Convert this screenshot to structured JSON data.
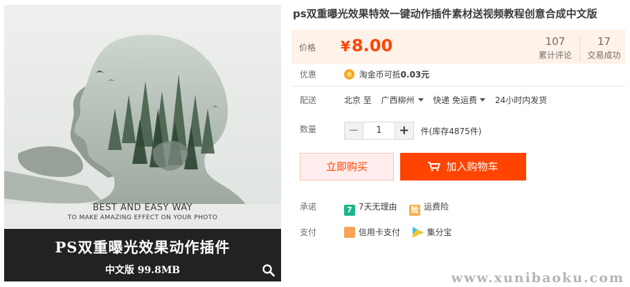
{
  "image": {
    "caption_line1": "BEST AND EASY WAY",
    "caption_line2": "TO MAKE AMAZING  EFFECT ON YOUR PHOTO",
    "band_title": "PS双重曝光效果动作插件",
    "band_subtitle": "中文版  99.8MB",
    "zoom_icon": "search-icon"
  },
  "product": {
    "title": "ps双重曝光效果特效一键动作插件素材送视频教程创意合成中文版"
  },
  "price": {
    "label": "价格",
    "currency": "¥",
    "amount": "8.00",
    "color": "#ff4400"
  },
  "stats": {
    "reviews_count": "107",
    "reviews_label": "累计评论",
    "sales_count": "17",
    "sales_label": "交易成功"
  },
  "promo": {
    "label": "优惠",
    "icon": "coin-icon",
    "text_prefix": "淘金币可抵",
    "text_amount": "0.03元"
  },
  "shipping": {
    "label": "配送",
    "from": "北京 至",
    "to": "广西柳州",
    "method": "快递 免运费",
    "dispatch": "24小时内发货"
  },
  "quantity": {
    "label": "数量",
    "value": "1",
    "minus": "−",
    "plus": "+",
    "stock_text": "件(库存4875件)"
  },
  "actions": {
    "buy_now": "立即购买",
    "add_to_cart": "加入购物车",
    "accent": "#ff4400"
  },
  "promise": {
    "label": "承诺",
    "items": [
      "7天无理由",
      "运费险"
    ]
  },
  "payment": {
    "label": "支付",
    "items": [
      "信用卡支付",
      "集分宝"
    ]
  },
  "watermark": "www.xunibaoku.com"
}
